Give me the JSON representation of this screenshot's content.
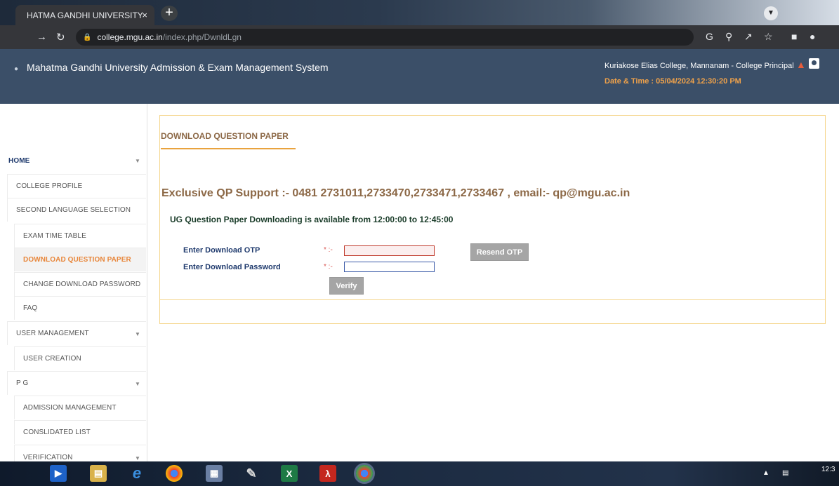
{
  "browser": {
    "tab_title": "HATMA GANDHI UNIVERSITY",
    "tab_close": "×",
    "new_tab": "+",
    "url_host": "college.mgu.ac.in",
    "url_path": "/index.php/DwnldLgn"
  },
  "header": {
    "title": "Mahatma Gandhi University Admission & Exam Management System",
    "org_info": "Kuriakose Elias College, Mannanam - College Principal",
    "datetime": "Date & Time : 05/04/2024 12:30:20 PM"
  },
  "sidebar": {
    "items": [
      {
        "label": "HOME"
      },
      {
        "label": "COLLEGE PROFILE"
      },
      {
        "label": "SECOND LANGUAGE SELECTION"
      },
      {
        "label": "EXAM TIME TABLE"
      },
      {
        "label": "DOWNLOAD QUESTION PAPER"
      },
      {
        "label": "CHANGE DOWNLOAD PASSWORD"
      },
      {
        "label": "FAQ"
      },
      {
        "label": "USER MANAGEMENT"
      },
      {
        "label": "USER CREATION"
      },
      {
        "label": "P G"
      },
      {
        "label": "ADMISSION MANAGEMENT"
      },
      {
        "label": "CONSLIDATED LIST"
      },
      {
        "label": "VERIFICATION"
      }
    ]
  },
  "main": {
    "panel_title": "DOWNLOAD QUESTION PAPER",
    "support_text": "Exclusive QP Support :- 0481 2731011,2733470,2733471,2733467 , email:- qp@mgu.ac.in",
    "notice": "UG Question Paper Downloading is available from 12:00:00 to 12:45:00",
    "otp_label": "Enter Download OTP",
    "password_label": "Enter Download Password",
    "required_marker": "* :-",
    "otp_value": "",
    "password_value": "",
    "resend_label": "Resend OTP",
    "verify_label": "Verify"
  },
  "taskbar": {
    "clock": "12:3"
  }
}
